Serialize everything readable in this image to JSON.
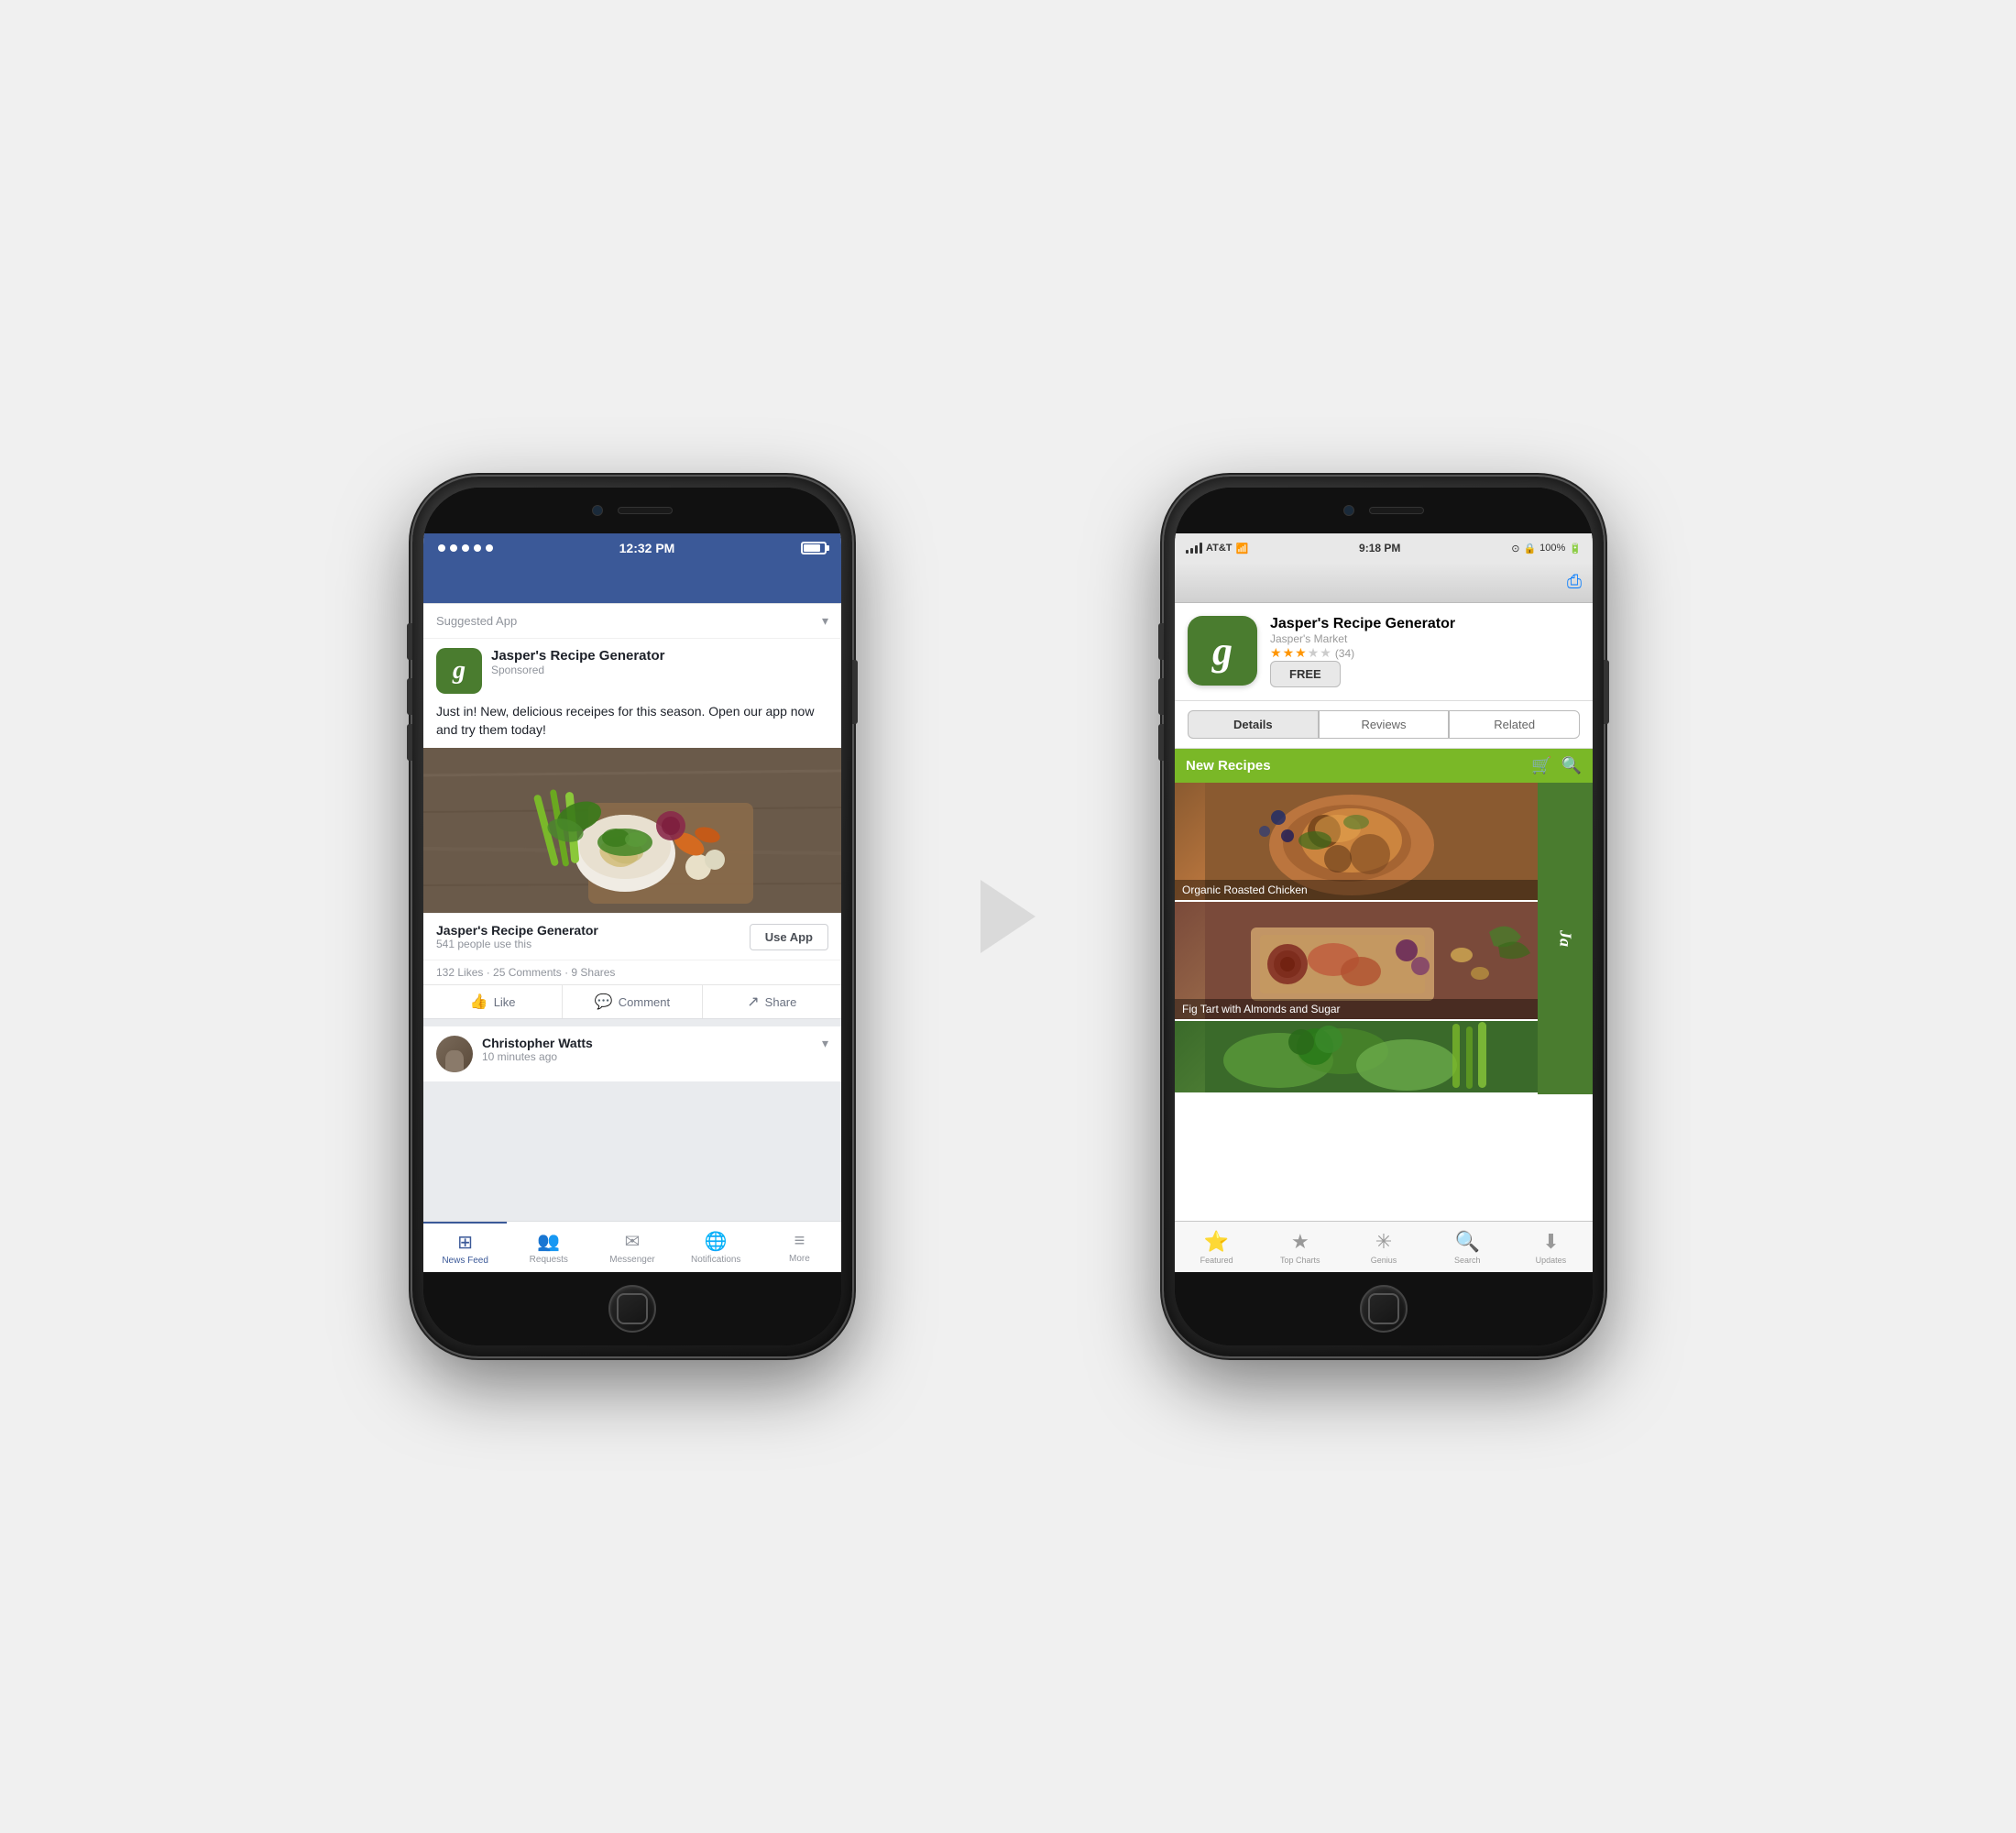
{
  "phone1": {
    "statusBar": {
      "time": "12:32 PM"
    },
    "suggestedLabel": "Suggested App",
    "appName": "Jasper's Recipe Generator",
    "appSponsored": "Sponsored",
    "adText": "Just in! New, delicious receipes for this season. Open our app now and try them today!",
    "useAppTitle": "Jasper's Recipe Generator",
    "useAppCount": "541 people use this",
    "useAppButton": "Use App",
    "likesRow": "132 Likes · 25 Comments · 9 Shares",
    "actions": [
      "Like",
      "Comment",
      "Share"
    ],
    "postUser": "Christopher Watts",
    "postTime": "10 minutes ago",
    "tabBar": [
      {
        "label": "News Feed",
        "active": true
      },
      {
        "label": "Requests",
        "active": false
      },
      {
        "label": "Messenger",
        "active": false
      },
      {
        "label": "Notifications",
        "active": false
      },
      {
        "label": "More",
        "active": false
      }
    ]
  },
  "phone2": {
    "statusBar": {
      "carrier": "AT&T",
      "time": "9:18 PM",
      "battery": "100%"
    },
    "appName": "Jasper's Recipe Generator",
    "appDeveloper": "Jasper's Market",
    "ratingCount": "(34)",
    "freeButton": "FREE",
    "tabs": [
      "Details",
      "Reviews",
      "Related"
    ],
    "activeTab": "Details",
    "recipesHeader": "New Recipes",
    "recipes": [
      {
        "label": "Organic Roasted Chicken"
      },
      {
        "label": "Fig Tart with Almonds and Sugar"
      },
      {
        "label": ""
      }
    ],
    "tabBar": [
      {
        "label": "Featured",
        "active": false
      },
      {
        "label": "Top Charts",
        "active": false
      },
      {
        "label": "Genius",
        "active": false
      },
      {
        "label": "Search",
        "active": false
      },
      {
        "label": "Updates",
        "active": false
      }
    ]
  }
}
